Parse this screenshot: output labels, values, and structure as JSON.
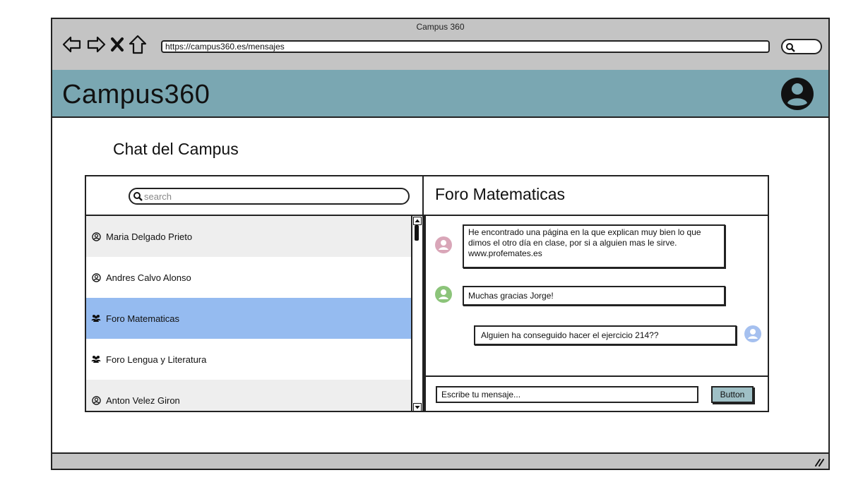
{
  "browser": {
    "window_title": "Campus 360",
    "url": "https://campus360.es/mensajes",
    "nav_icons": [
      "back-arrow-icon",
      "forward-arrow-icon",
      "close-x-icon",
      "home-icon"
    ],
    "search_icon": "search-icon"
  },
  "app": {
    "brand": "Campus360",
    "header_color": "#7aa7b2",
    "avatar_icon": "user-avatar-icon"
  },
  "page": {
    "title": "Chat del Campus"
  },
  "contacts": {
    "search_placeholder": "search",
    "items": [
      {
        "label": "Maria Delgado Prieto",
        "icon": "user-circle-icon"
      },
      {
        "label": "Andres Calvo Alonso",
        "icon": "user-circle-icon"
      },
      {
        "label": "Foro Matematicas",
        "icon": "group-icon"
      },
      {
        "label": "Foro Lengua y Literatura",
        "icon": "group-icon"
      },
      {
        "label": "Anton Velez Giron",
        "icon": "user-circle-icon"
      }
    ],
    "selected_index": 2,
    "selected_color": "#95bbf0"
  },
  "chat": {
    "title": "Foro Matematicas",
    "messages": [
      {
        "text": "He encontrado una página en la que explican muy bien lo que dimos el otro día en clase, por si a alguien mas le sirve. www.profemates.es",
        "avatar_color": "#d9a6b8",
        "side": "left"
      },
      {
        "text": "Muchas gracias Jorge!",
        "avatar_color": "#8cc47a",
        "side": "left"
      },
      {
        "text": "Alguien ha conseguido hacer el ejercicio 214??",
        "avatar_color": "#a5c0ef",
        "side": "right"
      }
    ],
    "input_placeholder": "Escribe tu mensaje...",
    "send_label": "Button"
  }
}
